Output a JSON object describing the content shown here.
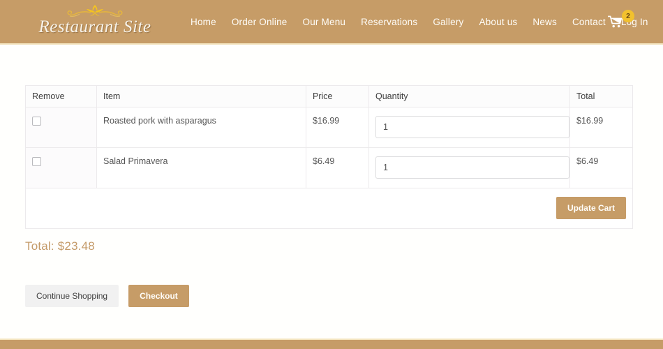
{
  "header": {
    "brand_name": "Restaurant Site",
    "brand_ornament_icon": "floral-flourish-icon",
    "nav_items": [
      {
        "label": "Home"
      },
      {
        "label": "Order Online"
      },
      {
        "label": "Our Menu"
      },
      {
        "label": "Reservations"
      },
      {
        "label": "Gallery"
      },
      {
        "label": "About us"
      },
      {
        "label": "News"
      },
      {
        "label": "Contact"
      },
      {
        "label": "Log In"
      }
    ],
    "cart": {
      "icon": "shopping-cart-icon",
      "badge_count": "2"
    },
    "colors": {
      "bar_background": "#c69c67",
      "bar_underline": "#f3e3bd",
      "nav_text": "#fffdf8",
      "badge_background": "#f2c12e",
      "badge_text": "#6b4a13"
    }
  },
  "cart_table": {
    "columns": [
      "Remove",
      "Item",
      "Price",
      "Quantity",
      "Total"
    ],
    "rows": [
      {
        "remove_checked": false,
        "item": "Roasted pork with asparagus",
        "price": "$16.99",
        "quantity": "1",
        "total": "$16.99"
      },
      {
        "remove_checked": false,
        "item": "Salad Primavera",
        "price": "$6.49",
        "quantity": "1",
        "total": "$6.49"
      }
    ],
    "update_cart_label": "Update Cart"
  },
  "summary": {
    "total_label": "Total: $23.48",
    "total_color": "#c49a68"
  },
  "footer_actions": {
    "continue_shopping_label": "Continue Shopping",
    "checkout_label": "Checkout"
  },
  "theme": {
    "accent": "#c69c67",
    "page_background": "#fffffd",
    "table_border": "#eceaec"
  }
}
